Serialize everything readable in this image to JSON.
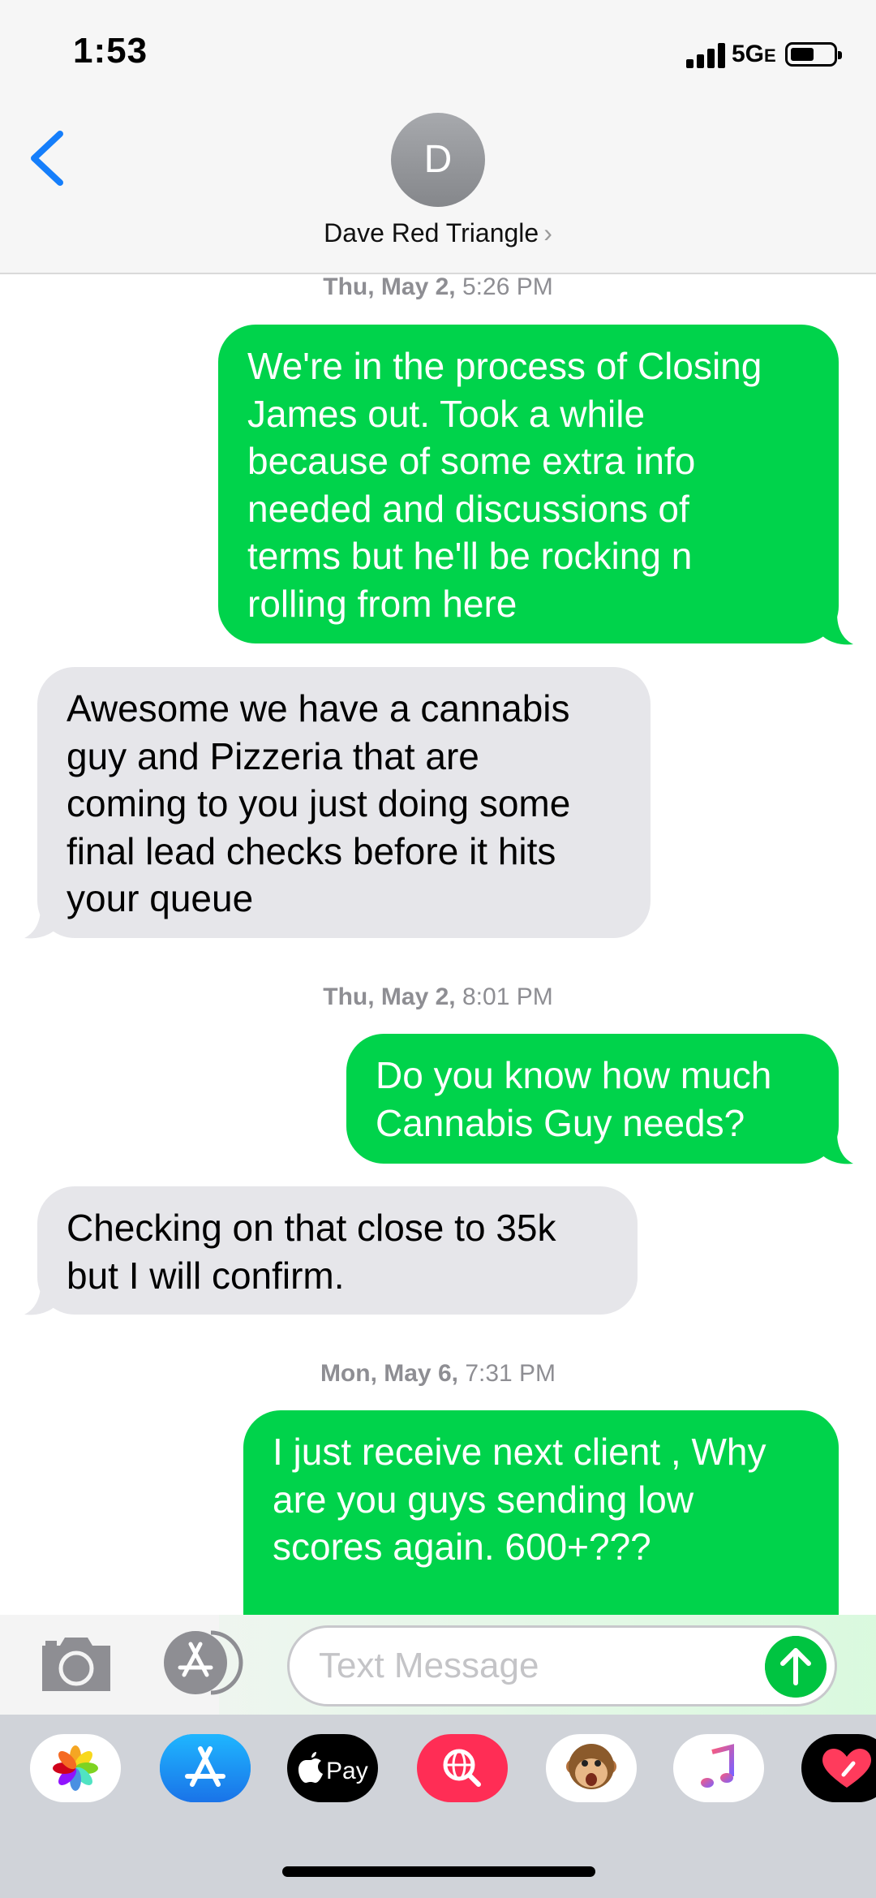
{
  "status_bar": {
    "time": "1:53",
    "network": "5G",
    "network_suffix": "E"
  },
  "header": {
    "avatar_initial": "D",
    "contact_name": "Dave Red Triangle",
    "chevron": "›"
  },
  "messages": [
    {
      "type": "timestamp",
      "day": "Thu, May 2,",
      "time": "5:26 PM"
    },
    {
      "type": "sent",
      "lines": [
        "We're in the process of Closing",
        "James out.  Took a while",
        "because of some extra info",
        "needed and discussions of",
        "terms but he'll be rocking n",
        "rolling from here"
      ]
    },
    {
      "type": "received",
      "lines": [
        "Awesome we have a cannabis",
        "guy and Pizzeria that are",
        "coming to you just doing some",
        "final lead checks before it hits",
        "your queue"
      ]
    },
    {
      "type": "timestamp",
      "day": "Thu, May 2,",
      "time": "8:01 PM"
    },
    {
      "type": "sent",
      "lines": [
        "Do you know how much",
        "Cannabis Guy needs?"
      ]
    },
    {
      "type": "received",
      "lines": [
        "Checking on that close to 35k",
        "but I will confirm."
      ]
    },
    {
      "type": "timestamp",
      "day": "Mon, May 6,",
      "time": "7:31 PM"
    },
    {
      "type": "sent",
      "lines": [
        "I just receive next client , Why",
        "are you guys sending low",
        "scores again. 600+???"
      ]
    }
  ],
  "compose": {
    "placeholder": "Text Message"
  },
  "app_drawer": [
    "photos-icon",
    "app-store-icon",
    "apple-pay-icon",
    "web-search-icon",
    "animoji-monkey-icon",
    "music-icon",
    "digital-touch-icon"
  ],
  "app_drawer_labels": {
    "pay": "Pay"
  },
  "colors": {
    "sent_bubble": "#00d34b",
    "received_bubble": "#e6e6ea",
    "ios_blue": "#157efb",
    "send_button": "#00c441"
  }
}
